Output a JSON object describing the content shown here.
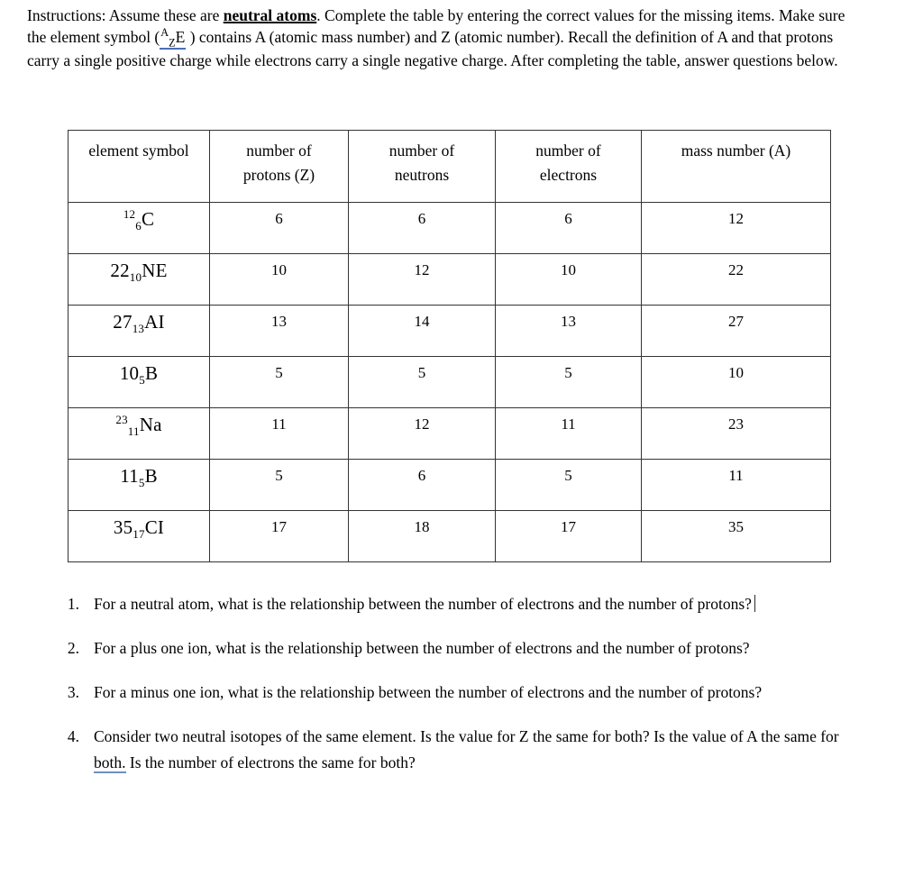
{
  "instructions": {
    "part1": "Instructions:  Assume these are ",
    "emphasis": "neutral atoms",
    "part2": ". Complete the table by entering the correct values for the missing items. Make sure the element symbol (",
    "symbol_sup": "A",
    "symbol_sub": "Z",
    "symbol_letter": "E",
    "part3": " ) contains A (atomic mass number) and Z (atomic number). Recall the definition of A and that protons carry a single positive charge while electrons carry a single negative charge. After completing the table, answer questions below."
  },
  "table": {
    "headers": [
      "element symbol",
      "number of protons (Z)",
      "number of neutrons",
      "number of electrons",
      "mass number (A)"
    ],
    "headers_lines": [
      [
        "element symbol"
      ],
      [
        "number of",
        "protons (Z)"
      ],
      [
        "number of",
        "neutrons"
      ],
      [
        "number of",
        "electrons"
      ],
      [
        "mass number (A)"
      ]
    ],
    "rows": [
      {
        "symbol": {
          "mass": "12",
          "mass_style": "sup",
          "z": "6",
          "element": "C"
        },
        "symbol_text": "12 6 C",
        "protons": "6",
        "neutrons": "6",
        "electrons": "6",
        "mass_number": "12"
      },
      {
        "symbol": {
          "mass": "22",
          "mass_style": "normal",
          "z": "10",
          "element": "NE"
        },
        "symbol_text": "22 10 NE",
        "protons": "10",
        "neutrons": "12",
        "electrons": "10",
        "mass_number": "22"
      },
      {
        "symbol": {
          "mass": "27",
          "mass_style": "normal",
          "z": "13",
          "element": "AI"
        },
        "symbol_text": "27 13 AI",
        "protons": "13",
        "neutrons": "14",
        "electrons": "13",
        "mass_number": "27"
      },
      {
        "symbol": {
          "mass": "10",
          "mass_style": "normal",
          "z": "5",
          "element": "B"
        },
        "symbol_text": "10 5 B",
        "protons": "5",
        "neutrons": "5",
        "electrons": "5",
        "mass_number": "10"
      },
      {
        "symbol": {
          "mass": "23",
          "mass_style": "sup",
          "z": "11",
          "element": "Na"
        },
        "symbol_text": "23 11 Na",
        "protons": "11",
        "neutrons": "12",
        "electrons": "11",
        "mass_number": "23"
      },
      {
        "symbol": {
          "mass": "11",
          "mass_style": "normal",
          "z": "5",
          "element": "B"
        },
        "symbol_text": "11 5 B",
        "protons": "5",
        "neutrons": "6",
        "electrons": "5",
        "mass_number": "11"
      },
      {
        "symbol": {
          "mass": "35",
          "mass_style": "normal",
          "z": "17",
          "element": "CI"
        },
        "symbol_text": "35 17 CI",
        "protons": "17",
        "neutrons": "18",
        "electrons": "17",
        "mass_number": "35"
      }
    ]
  },
  "questions": [
    {
      "number": "1.",
      "text": "For a neutral atom, what is the relationship between the number of electrons and the number of protons?",
      "has_caret": true
    },
    {
      "number": "2.",
      "text": "For a plus one ion, what is the relationship between the number of electrons and the number of protons?",
      "has_caret": false
    },
    {
      "number": "3.",
      "text": "For a minus one ion, what is the relationship between the number of electrons and the number of protons?",
      "has_caret": false
    },
    {
      "number": "4.",
      "text_before": "Consider two neutral isotopes of the same element.  Is the value for Z the same for both? Is the value of A the same for ",
      "spellcheck_word": "both.",
      "text_after": " Is the number of electrons the same for both?",
      "text": "Consider two neutral isotopes of the same element.  Is the value for Z the same for both? Is the value of A the same for both. Is the number of electrons the same for both?",
      "has_caret": false
    }
  ],
  "colors": {
    "text": "#000000",
    "border": "#343434",
    "spellcheck_underline": "#6f8fc4",
    "background": "#ffffff"
  }
}
